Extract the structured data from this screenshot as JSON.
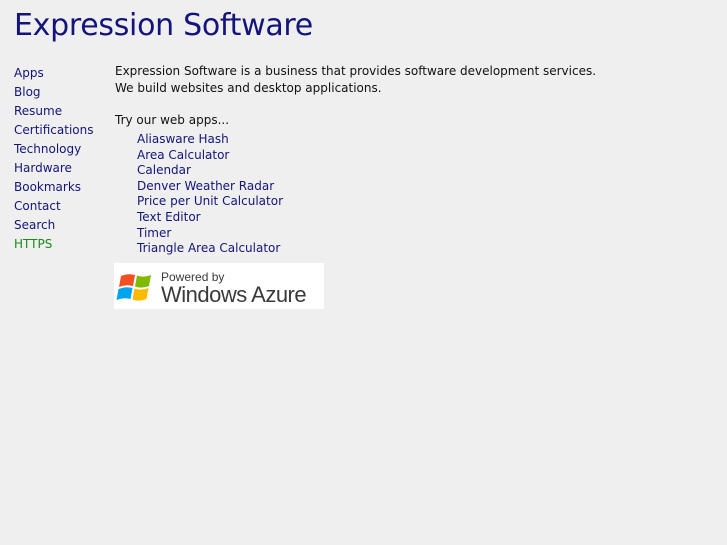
{
  "site": {
    "title": "Expression Software"
  },
  "sidebar": {
    "items": [
      {
        "label": "Apps"
      },
      {
        "label": "Blog"
      },
      {
        "label": "Resume"
      },
      {
        "label": "Certifications"
      },
      {
        "label": "Technology"
      },
      {
        "label": "Hardware"
      },
      {
        "label": "Bookmarks"
      },
      {
        "label": "Contact"
      },
      {
        "label": "Search"
      },
      {
        "label": "HTTPS"
      }
    ]
  },
  "main": {
    "intro_line1": "Expression Software is a business that provides software development services.",
    "intro_line2": "We build websites and desktop applications.",
    "apps_heading": "Try our web apps...",
    "apps": [
      {
        "label": "Aliasware Hash"
      },
      {
        "label": "Area Calculator"
      },
      {
        "label": "Calendar"
      },
      {
        "label": "Denver Weather Radar"
      },
      {
        "label": "Price per Unit Calculator"
      },
      {
        "label": "Text Editor"
      },
      {
        "label": "Timer"
      },
      {
        "label": "Triangle Area Calculator"
      }
    ]
  },
  "badge": {
    "line1": "Powered by",
    "line2": "Windows Azure",
    "icon": "windows-flag-icon"
  },
  "colors": {
    "background": "#efefef",
    "title": "#14147a",
    "link": "#14147a",
    "https_link": "#1a8a1a",
    "text": "#111111",
    "badge_text": "#3a3a3a"
  }
}
